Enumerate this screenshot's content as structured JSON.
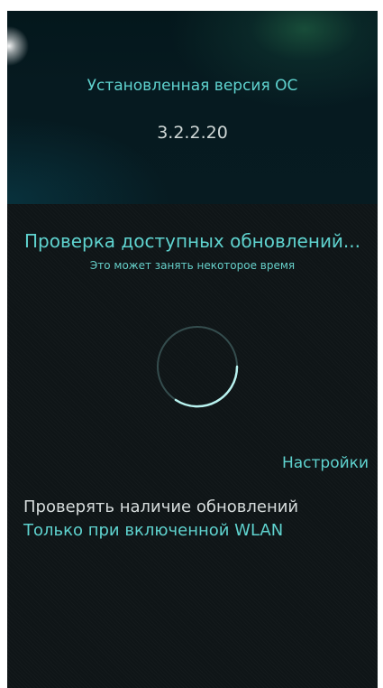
{
  "header": {
    "label": "Установленная версия ОС",
    "version": "3.2.2.20"
  },
  "status": {
    "title": "Проверка доступных обновлений...",
    "subtitle": "Это может занять некоторое время"
  },
  "settings": {
    "section_title": "Настройки",
    "check_updates": {
      "label": "Проверять наличие обновлений",
      "value": "Только при включенной WLAN"
    }
  },
  "colors": {
    "accent": "#5fd3cf",
    "text_primary": "#d6dcdc",
    "background": "#0f1517"
  },
  "icons": {
    "spinner": "busy-indicator-icon"
  }
}
